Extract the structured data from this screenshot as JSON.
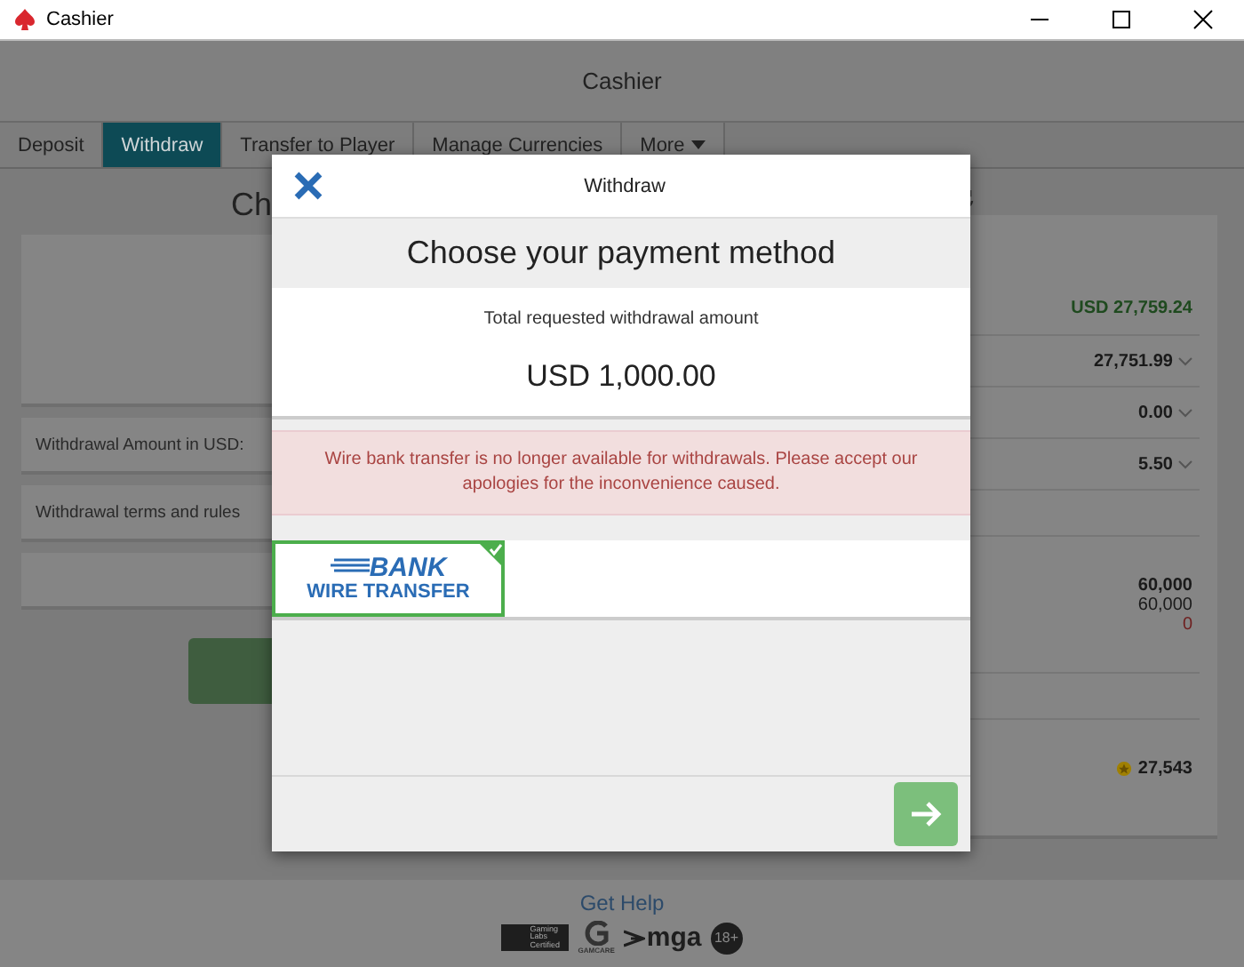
{
  "window": {
    "title": "Cashier"
  },
  "header": {
    "title": "Cashier"
  },
  "tabs": [
    {
      "label": "Deposit",
      "selected": false
    },
    {
      "label": "Withdraw",
      "selected": true
    },
    {
      "label": "Transfer to Player",
      "selected": false
    },
    {
      "label": "Manage Currencies",
      "selected": false
    },
    {
      "label": "More",
      "selected": false,
      "dropdown": true
    }
  ],
  "left_panel": {
    "heading": "Ch",
    "rows": [
      {
        "label": ""
      },
      {
        "label": "Withdrawal Amount in USD:"
      },
      {
        "label": "Withdrawal terms and rules"
      },
      {
        "label": ""
      }
    ]
  },
  "right_panel": {
    "rows": [
      {
        "kind": "balance",
        "value": "USD 27,759.24"
      },
      {
        "kind": "dropdown",
        "value": "27,751.99"
      },
      {
        "kind": "dropdown",
        "value": "0.00"
      },
      {
        "kind": "dropdown",
        "value": "5.50"
      },
      {
        "kind": "blank",
        "value": ""
      },
      {
        "kind": "stack",
        "values": [
          "60,000",
          "60,000",
          "0"
        ]
      },
      {
        "kind": "blank",
        "value": ""
      },
      {
        "kind": "coins",
        "value": "27,543"
      }
    ]
  },
  "dialog": {
    "title": "Withdraw",
    "heading": "Choose your payment method",
    "amount_label": "Total requested withdrawal amount",
    "amount": "USD 1,000.00",
    "alert": "Wire bank transfer is no longer available for withdrawals. Please accept our apologies for the inconvenience caused.",
    "methods": [
      {
        "line1": "BANK",
        "line2": "WIRE TRANSFER",
        "selected": true
      }
    ]
  },
  "footer": {
    "help": "Get Help",
    "logos": [
      {
        "kind": "gli",
        "text": "Gaming Labs Certified"
      },
      {
        "kind": "gamcare",
        "text": "GAMCARE"
      },
      {
        "kind": "mga",
        "text": "mga"
      },
      {
        "kind": "age",
        "text": "18+"
      }
    ]
  }
}
